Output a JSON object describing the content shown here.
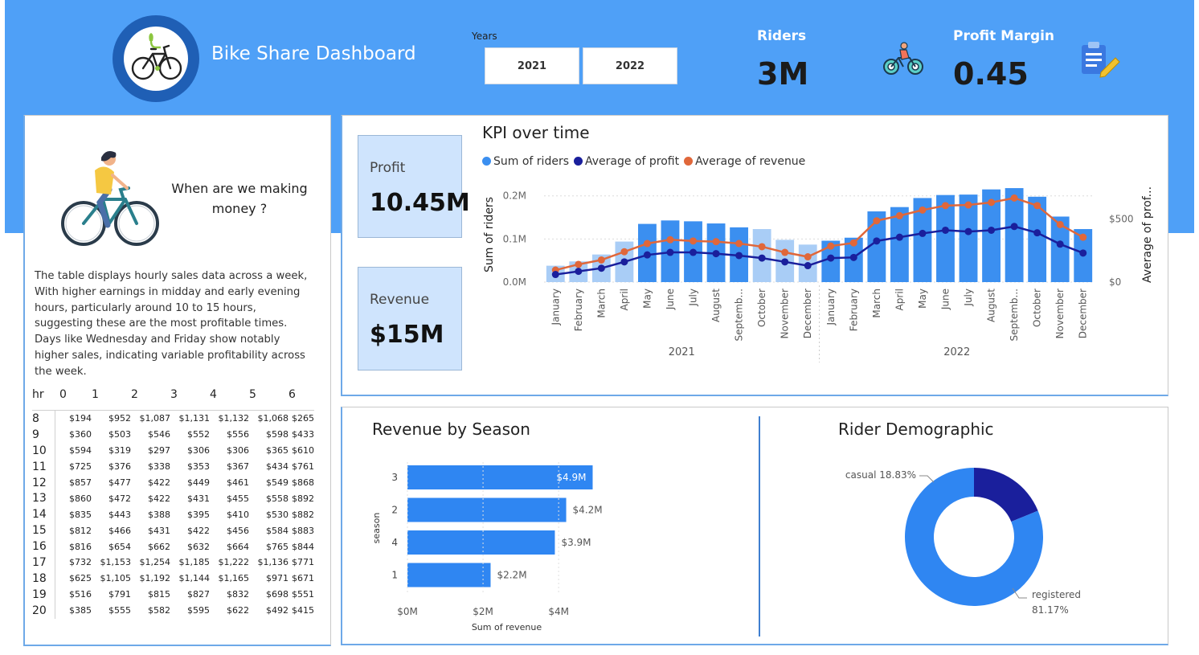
{
  "header": {
    "title": "Bike Share Dashboard",
    "years_label": "Years",
    "years": [
      "2021",
      "2022"
    ],
    "riders_label": "Riders",
    "riders_value": "3M",
    "profit_margin_label": "Profit Margin",
    "profit_margin_value": "0.45"
  },
  "icons": {
    "logo": "bike-logo-icon",
    "riders": "cyclist-icon",
    "profit_margin": "clipboard-pencil-icon",
    "illustration": "woman-cycling-illustration"
  },
  "cards": {
    "profit_label": "Profit",
    "profit_value": "10.45M",
    "revenue_label": "Revenue",
    "revenue_value": "$15M"
  },
  "left_panel": {
    "heading": "When are we making money ?",
    "description": "The table displays hourly sales data across a week, With higher earnings in midday and early evening hours, particularly around 10 to 15 hours, suggesting these are the most profitable times. Days like Wednesday and Friday show notably higher sales, indicating variable profitability across the week.",
    "table": {
      "corner": "hr",
      "columns": [
        "0",
        "1",
        "2",
        "3",
        "4",
        "5",
        "6"
      ],
      "rows": [
        {
          "hr": "8",
          "values": [
            "$194",
            "$952",
            "$1,087",
            "$1,131",
            "$1,132",
            "$1,068",
            "$265"
          ]
        },
        {
          "hr": "9",
          "values": [
            "$360",
            "$503",
            "$546",
            "$552",
            "$556",
            "$598",
            "$433"
          ]
        },
        {
          "hr": "10",
          "values": [
            "$594",
            "$319",
            "$297",
            "$306",
            "$306",
            "$365",
            "$610"
          ]
        },
        {
          "hr": "11",
          "values": [
            "$725",
            "$376",
            "$338",
            "$353",
            "$367",
            "$434",
            "$761"
          ]
        },
        {
          "hr": "12",
          "values": [
            "$857",
            "$477",
            "$422",
            "$449",
            "$461",
            "$549",
            "$868"
          ]
        },
        {
          "hr": "13",
          "values": [
            "$860",
            "$472",
            "$422",
            "$431",
            "$455",
            "$558",
            "$892"
          ]
        },
        {
          "hr": "14",
          "values": [
            "$835",
            "$443",
            "$388",
            "$395",
            "$410",
            "$530",
            "$882"
          ]
        },
        {
          "hr": "15",
          "values": [
            "$812",
            "$466",
            "$431",
            "$422",
            "$456",
            "$584",
            "$883"
          ]
        },
        {
          "hr": "16",
          "values": [
            "$816",
            "$654",
            "$662",
            "$632",
            "$664",
            "$765",
            "$844"
          ]
        },
        {
          "hr": "17",
          "values": [
            "$732",
            "$1,153",
            "$1,254",
            "$1,185",
            "$1,222",
            "$1,136",
            "$771"
          ]
        },
        {
          "hr": "18",
          "values": [
            "$625",
            "$1,105",
            "$1,192",
            "$1,144",
            "$1,165",
            "$971",
            "$671"
          ]
        },
        {
          "hr": "19",
          "values": [
            "$516",
            "$791",
            "$815",
            "$827",
            "$832",
            "$698",
            "$551"
          ]
        },
        {
          "hr": "20",
          "values": [
            "$385",
            "$555",
            "$582",
            "$595",
            "$622",
            "$492",
            "$415"
          ]
        }
      ]
    }
  },
  "colors": {
    "header_bg": "#4fa0f7",
    "riders": "#3b8ff0",
    "riders_light": "#a9cdf6",
    "profit": "#1a1f9c",
    "revenue": "#e0673a",
    "card_bg": "#cfe4fd",
    "season_bar": "#2f86f2",
    "casual": "#1a1f9c",
    "registered": "#2f86f2"
  },
  "chart_data": [
    {
      "type": "bar",
      "title": "KPI over time",
      "legend": [
        "Sum of riders",
        "Average of profit",
        "Average of revenue"
      ],
      "legend_position": "top-left",
      "x": [
        "January",
        "February",
        "March",
        "April",
        "May",
        "June",
        "July",
        "August",
        "Septemb...",
        "October",
        "November",
        "December",
        "January",
        "February",
        "March",
        "April",
        "May",
        "June",
        "July",
        "August",
        "Septemb...",
        "October",
        "November",
        "December"
      ],
      "x_groups": [
        "2021",
        "2022"
      ],
      "xlabel": "",
      "ylabel": "Sum of riders",
      "ylabel_right": "Average of prof...",
      "y_ticks": [
        "0.0M",
        "0.1M",
        "0.2M"
      ],
      "y_right_ticks": [
        "$0",
        "$500"
      ],
      "ylim": [
        0,
        0.22
      ],
      "ylim_right": [
        0,
        750
      ],
      "grid": true,
      "series": [
        {
          "name": "Sum of riders",
          "axis": "left",
          "values": [
            0.038,
            0.048,
            0.064,
            0.094,
            0.135,
            0.143,
            0.141,
            0.136,
            0.127,
            0.123,
            0.098,
            0.087,
            0.096,
            0.103,
            0.164,
            0.174,
            0.195,
            0.202,
            0.203,
            0.215,
            0.218,
            0.198,
            0.152,
            0.123
          ]
        },
        {
          "name": "Average of profit",
          "axis": "right",
          "values": [
            60,
            85,
            110,
            160,
            215,
            235,
            235,
            225,
            210,
            190,
            160,
            130,
            190,
            195,
            325,
            355,
            385,
            410,
            400,
            410,
            440,
            390,
            300,
            230
          ]
        },
        {
          "name": "Average of revenue",
          "axis": "right",
          "values": [
            95,
            140,
            175,
            240,
            305,
            335,
            325,
            320,
            305,
            280,
            235,
            200,
            285,
            310,
            485,
            525,
            570,
            605,
            610,
            630,
            665,
            605,
            455,
            355
          ]
        }
      ]
    },
    {
      "type": "bar",
      "orientation": "horizontal",
      "title": "Revenue by Season",
      "categories": [
        "3",
        "2",
        "4",
        "1"
      ],
      "values": [
        4.9,
        4.2,
        3.9,
        2.2
      ],
      "value_labels": [
        "$4.9M",
        "$4.2M",
        "$3.9M",
        "$2.2M"
      ],
      "unit": "$M",
      "xlabel": "Sum of revenue",
      "ylabel": "season",
      "x_ticks": [
        "$0M",
        "$2M",
        "$4M"
      ],
      "xlim": [
        0,
        5.4
      ]
    },
    {
      "type": "pie",
      "donut": true,
      "title": "Rider Demographic",
      "categories": [
        "casual",
        "registered"
      ],
      "values": [
        18.83,
        81.17
      ],
      "labels": [
        "casual 18.83%",
        "registered",
        "81.17%"
      ]
    }
  ]
}
